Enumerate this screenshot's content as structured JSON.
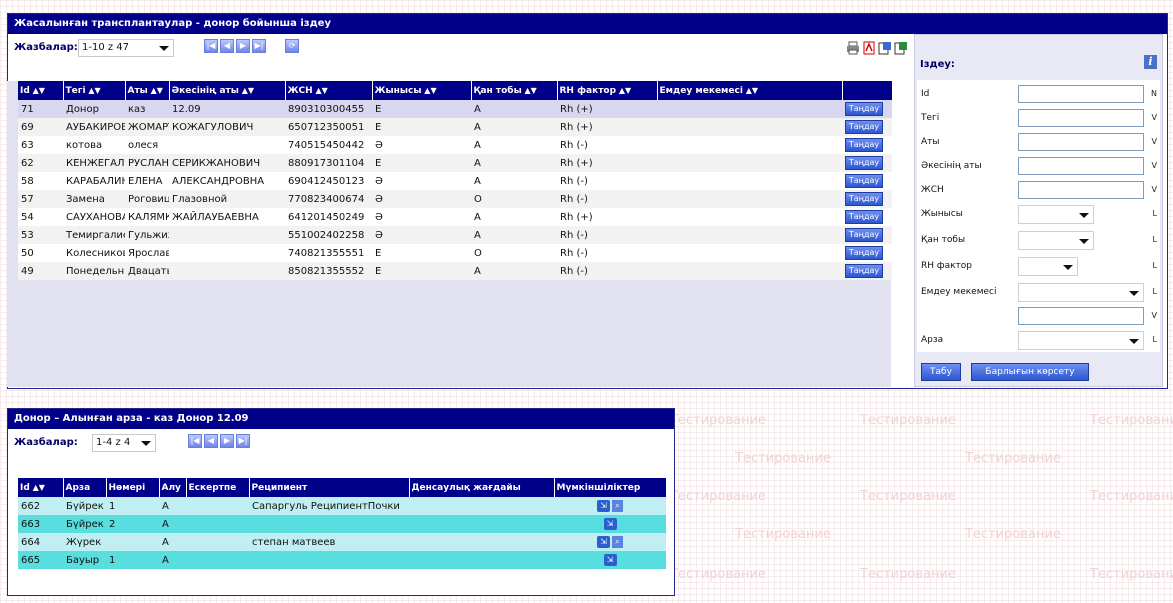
{
  "watermark": {
    "text": "Тестирование"
  },
  "donor_window": {
    "title": "Жасалынған трансплантаулар - донор бойынша іздеу",
    "records_label": "Жазбалар:",
    "records_value": "1-10 z 47",
    "columns": [
      "Id",
      "Тегі",
      "Аты",
      "Әкесінің аты",
      "ЖСН",
      "Жынысы",
      "Қан тобы",
      "RH фактор",
      "Емдеу мекемесі",
      ""
    ],
    "rows": [
      {
        "id": "71",
        "surname": "Донор",
        "name": "каз",
        "patronymic": "12.09",
        "jsn": "890310300455",
        "sex": "Е",
        "blood": "А",
        "rh": "Rh (+)",
        "clinic": "",
        "btn": "Таңдау"
      },
      {
        "id": "69",
        "surname": "АУБАКИРОВ",
        "name": "ЖОМАРТ",
        "patronymic": "КОЖАГУЛОВИЧ",
        "jsn": "650712350051",
        "sex": "Е",
        "blood": "А",
        "rh": "Rh (+)",
        "clinic": "",
        "btn": "Таңдау"
      },
      {
        "id": "63",
        "surname": "котова",
        "name": "олеся",
        "patronymic": "",
        "jsn": "740515450442",
        "sex": "Ә",
        "blood": "А",
        "rh": "Rh (-)",
        "clinic": "",
        "btn": "Таңдау"
      },
      {
        "id": "62",
        "surname": "КЕНЖЕГАЛИЕВ",
        "name": "РУСЛАН",
        "patronymic": "СЕРИКЖАНОВИЧ",
        "jsn": "880917301104",
        "sex": "Е",
        "blood": "А",
        "rh": "Rh (+)",
        "clinic": "",
        "btn": "Таңдау"
      },
      {
        "id": "58",
        "surname": "КАРАБАЛИНА",
        "name": "ЕЛЕНА",
        "patronymic": "АЛЕКСАНДРОВНА",
        "jsn": "690412450123",
        "sex": "Ә",
        "blood": "А",
        "rh": "Rh (-)",
        "clinic": "",
        "btn": "Таңдау"
      },
      {
        "id": "57",
        "surname": "Замена",
        "name": "Роговицы",
        "patronymic": "Глазовной",
        "jsn": "770823400674",
        "sex": "Ә",
        "blood": "O",
        "rh": "Rh (-)",
        "clinic": "",
        "btn": "Таңдау"
      },
      {
        "id": "54",
        "surname": "САУХАНОВА",
        "name": "КАЛЯМКАС",
        "patronymic": "ЖАЙЛАУБАЕВНА",
        "jsn": "641201450249",
        "sex": "Ә",
        "blood": "А",
        "rh": "Rh (+)",
        "clinic": "",
        "btn": "Таңдау"
      },
      {
        "id": "53",
        "surname": "Темиргалиева",
        "name": "Гульжихан",
        "patronymic": "",
        "jsn": "551002402258",
        "sex": "Ә",
        "blood": "А",
        "rh": "Rh (-)",
        "clinic": "",
        "btn": "Таңдау"
      },
      {
        "id": "50",
        "surname": "Колесников",
        "name": "Ярослав",
        "patronymic": "",
        "jsn": "740821355551",
        "sex": "Е",
        "blood": "O",
        "rh": "Rh (-)",
        "clinic": "",
        "btn": "Таңдау"
      },
      {
        "id": "49",
        "surname": "Понедельник",
        "name": "Двацатый",
        "patronymic": "",
        "jsn": "850821355552",
        "sex": "Е",
        "blood": "А",
        "rh": "Rh (-)",
        "clinic": "",
        "btn": "Таңдау"
      }
    ],
    "search": {
      "title": "Іздеу:",
      "fields": [
        {
          "label": "Id",
          "kind": "input",
          "type": "N"
        },
        {
          "label": "Тегі",
          "kind": "input",
          "type": "V"
        },
        {
          "label": "Аты",
          "kind": "input",
          "type": "V"
        },
        {
          "label": "Әкесінің аты",
          "kind": "input",
          "type": "V"
        },
        {
          "label": "ЖСН",
          "kind": "input",
          "type": "V"
        },
        {
          "label": "Жынысы",
          "kind": "select",
          "type": "L"
        },
        {
          "label": "Қан тобы",
          "kind": "select",
          "type": "L"
        },
        {
          "label": "RH фактор",
          "kind": "select",
          "type": "L"
        },
        {
          "label": "Емдеу мекемесі",
          "kind": "select",
          "type": "L"
        },
        {
          "label": "",
          "kind": "input",
          "type": "V"
        },
        {
          "label": "Арза",
          "kind": "select",
          "type": "L"
        }
      ],
      "find_button": "Табу",
      "show_all_button": "Барлығын көрсету"
    }
  },
  "apps_window": {
    "title": "Донор – Алынған арза - каз Донор 12.09",
    "records_label": "Жазбалар:",
    "records_value": "1-4 z 4",
    "columns": [
      "Id",
      "Арза",
      "Нөмері",
      "Алу",
      "Ескертпе",
      "Реципиент",
      "Денсаулық жағдайы",
      "Мүмкіншіліктер"
    ],
    "rows": [
      {
        "id": "662",
        "app": "Бүйрек",
        "num": "1",
        "take": "A",
        "note": "",
        "recipient": "Сапаргуль РеципиентПочки",
        "health": "",
        "actions": [
          "open",
          "search"
        ]
      },
      {
        "id": "663",
        "app": "Бүйрек",
        "num": "2",
        "take": "A",
        "note": "",
        "recipient": "",
        "health": "",
        "actions": [
          "open"
        ]
      },
      {
        "id": "664",
        "app": "Жүрек",
        "num": "",
        "take": "A",
        "note": "",
        "recipient": "степан матвеев",
        "health": "",
        "actions": [
          "open",
          "search"
        ]
      },
      {
        "id": "665",
        "app": "Бауыр",
        "num": "1",
        "take": "A",
        "note": "",
        "recipient": "",
        "health": "",
        "actions": [
          "open"
        ]
      }
    ]
  }
}
